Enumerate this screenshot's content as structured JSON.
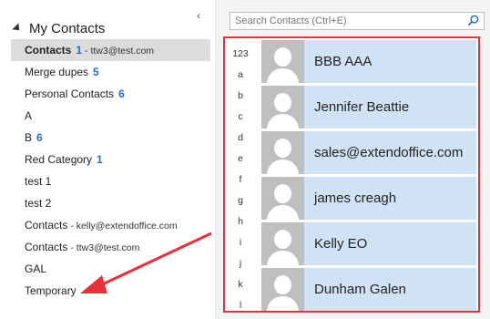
{
  "nav": {
    "header": "My Contacts",
    "folders": [
      {
        "name": "Contacts",
        "count": "1",
        "account": "- ttw3@test.com",
        "bold": true,
        "selected": true
      },
      {
        "name": "Merge dupes",
        "count": "5",
        "account": ""
      },
      {
        "name": "Personal Contacts",
        "count": "6",
        "account": ""
      },
      {
        "name": "A",
        "count": "",
        "account": ""
      },
      {
        "name": "B",
        "count": "6",
        "account": ""
      },
      {
        "name": "Red Category",
        "count": "1",
        "account": ""
      },
      {
        "name": "test 1",
        "count": "",
        "account": ""
      },
      {
        "name": "test 2",
        "count": "",
        "account": ""
      },
      {
        "name": "Contacts",
        "count": "",
        "account": "- kelly@extendoffice.com"
      },
      {
        "name": "Contacts",
        "count": "",
        "account": "- ttw3@test.com"
      },
      {
        "name": "GAL",
        "count": "",
        "account": ""
      },
      {
        "name": "Temporary",
        "count": "",
        "account": ""
      }
    ]
  },
  "search": {
    "placeholder": "Search Contacts (Ctrl+E)"
  },
  "alphabet": [
    "123",
    "a",
    "b",
    "c",
    "d",
    "e",
    "f",
    "g",
    "h",
    "i",
    "j",
    "k",
    "l"
  ],
  "contacts": [
    {
      "name": "BBB AAA"
    },
    {
      "name": "Jennifer Beattie"
    },
    {
      "name": "sales@extendoffice.com"
    },
    {
      "name": "james creagh"
    },
    {
      "name": "Kelly EO"
    },
    {
      "name": "Dunham Galen"
    }
  ],
  "colors": {
    "accent_count": "#1f6fc5",
    "highlight_border": "#e2323a",
    "card_bg": "#cfe3f5"
  }
}
